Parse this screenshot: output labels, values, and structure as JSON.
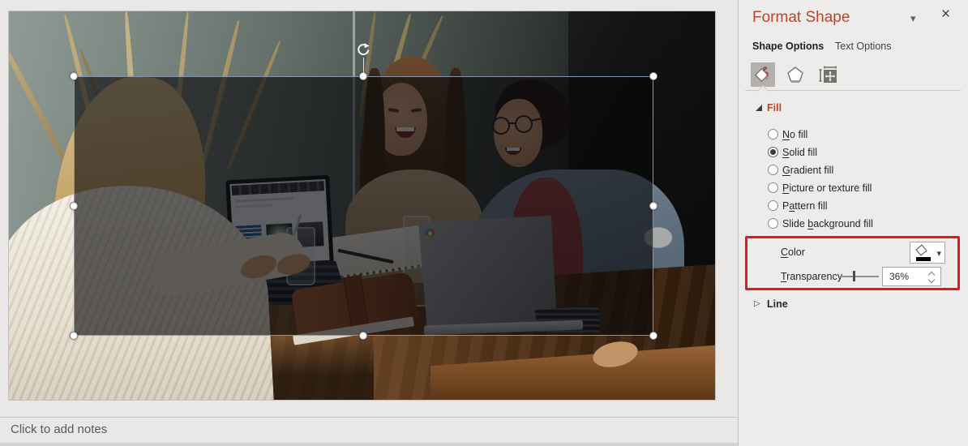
{
  "colors": {
    "pane_title_red": "#b7472a",
    "annotation_red": "#e2161c",
    "selection_border": "#8a9ab8",
    "current_fill_color": "#000000"
  },
  "notes": {
    "placeholder": "Click to add notes"
  },
  "panel": {
    "title": "Format Shape",
    "menu_glyph": "▾",
    "close_glyph": "×",
    "tabs": [
      {
        "label": "Shape Options",
        "active": true
      },
      {
        "label": "Text Options",
        "active": false
      }
    ],
    "toolbar": {
      "icons": [
        {
          "name": "fill-and-line",
          "selected": true
        },
        {
          "name": "effects",
          "selected": false
        },
        {
          "name": "size-and-properties",
          "selected": false
        }
      ]
    },
    "fill_section": {
      "header": "Fill",
      "expanded": true,
      "options": [
        {
          "pre": "",
          "key": "N",
          "post": "o fill",
          "selected": false
        },
        {
          "pre": "",
          "key": "S",
          "post": "olid fill",
          "selected": true
        },
        {
          "pre": "",
          "key": "G",
          "post": "radient fill",
          "selected": false
        },
        {
          "pre": "",
          "key": "P",
          "post": "icture or texture fill",
          "selected": false
        },
        {
          "pre": "P",
          "key": "a",
          "post": "ttern fill",
          "selected": false
        },
        {
          "pre": "Slide ",
          "key": "b",
          "post": "ackground fill",
          "selected": false
        }
      ],
      "color_row": {
        "label_key": "C",
        "label_post": "olor"
      },
      "transparency_row": {
        "label_key": "T",
        "label_post": "ransparency",
        "value": "36%",
        "percent": 36
      }
    },
    "line_section": {
      "header": "Line",
      "expanded": false,
      "glyph": "▷"
    }
  }
}
